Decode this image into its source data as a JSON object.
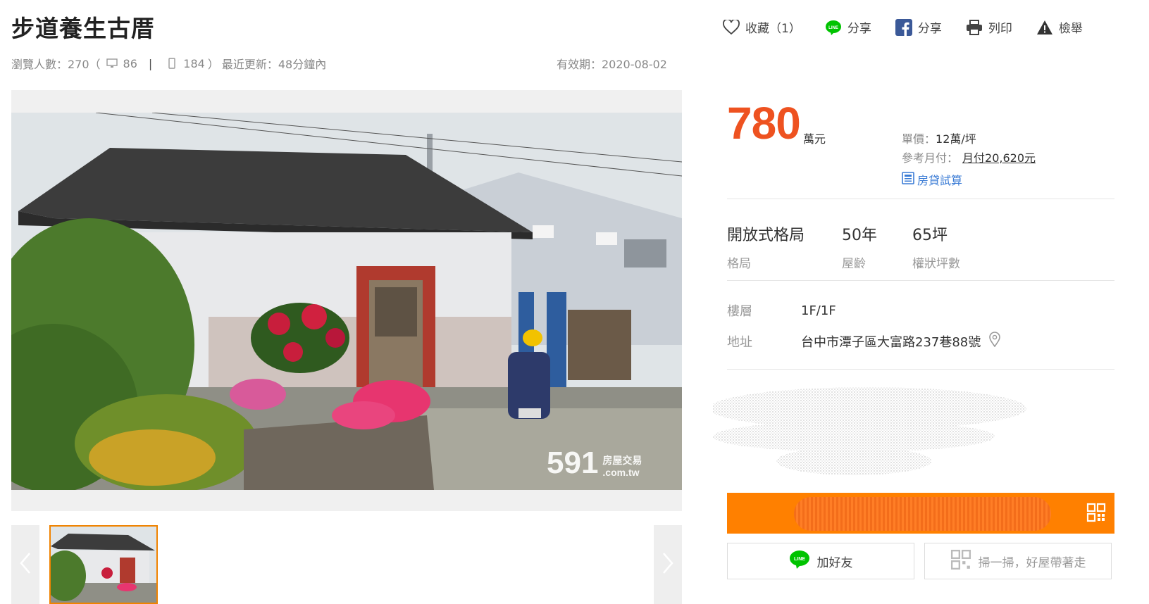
{
  "listing": {
    "title": "步道養生古厝",
    "views_label": "瀏覽人數：270（",
    "views_desktop": "86",
    "views_mobile": "184",
    "views_close": "）",
    "sep": "|",
    "updated": "最近更新：48分鐘內",
    "valid_until": "有效期：2020-08-02"
  },
  "actions": {
    "favorite": "收藏（1）",
    "line_share": "分享",
    "fb_share": "分享",
    "print": "列印",
    "report": "檢舉"
  },
  "photo": {
    "watermark_num": "591",
    "watermark_line1": "房屋交易",
    "watermark_line2": ".com.tw"
  },
  "price": {
    "amount": "780",
    "unit": "萬元",
    "unit_price_label": "單價：",
    "unit_price_value": "12萬/坪",
    "monthly_label": "參考月付：",
    "monthly_value": "月付20,620元",
    "loan_calc": "房貸試算"
  },
  "specs": [
    {
      "value": "開放式格局",
      "key": "格局"
    },
    {
      "value": "50年",
      "key": "屋齡"
    },
    {
      "value": "65坪",
      "key": "權狀坪數"
    }
  ],
  "details": {
    "floor_label": "樓層",
    "floor_value": "1F/1F",
    "address_label": "地址",
    "address_value": "台中市潭子區大富路237巷88號"
  },
  "contact": {
    "line_add": "加好友",
    "scan": "掃一掃，好屋帶著走"
  },
  "colors": {
    "price": "#ee5220",
    "contact_bar": "#ff8000",
    "thumb_border": "#f08300",
    "link_blue": "#3a7bd5",
    "line_green": "#00c300",
    "fb_blue": "#3b5998"
  }
}
